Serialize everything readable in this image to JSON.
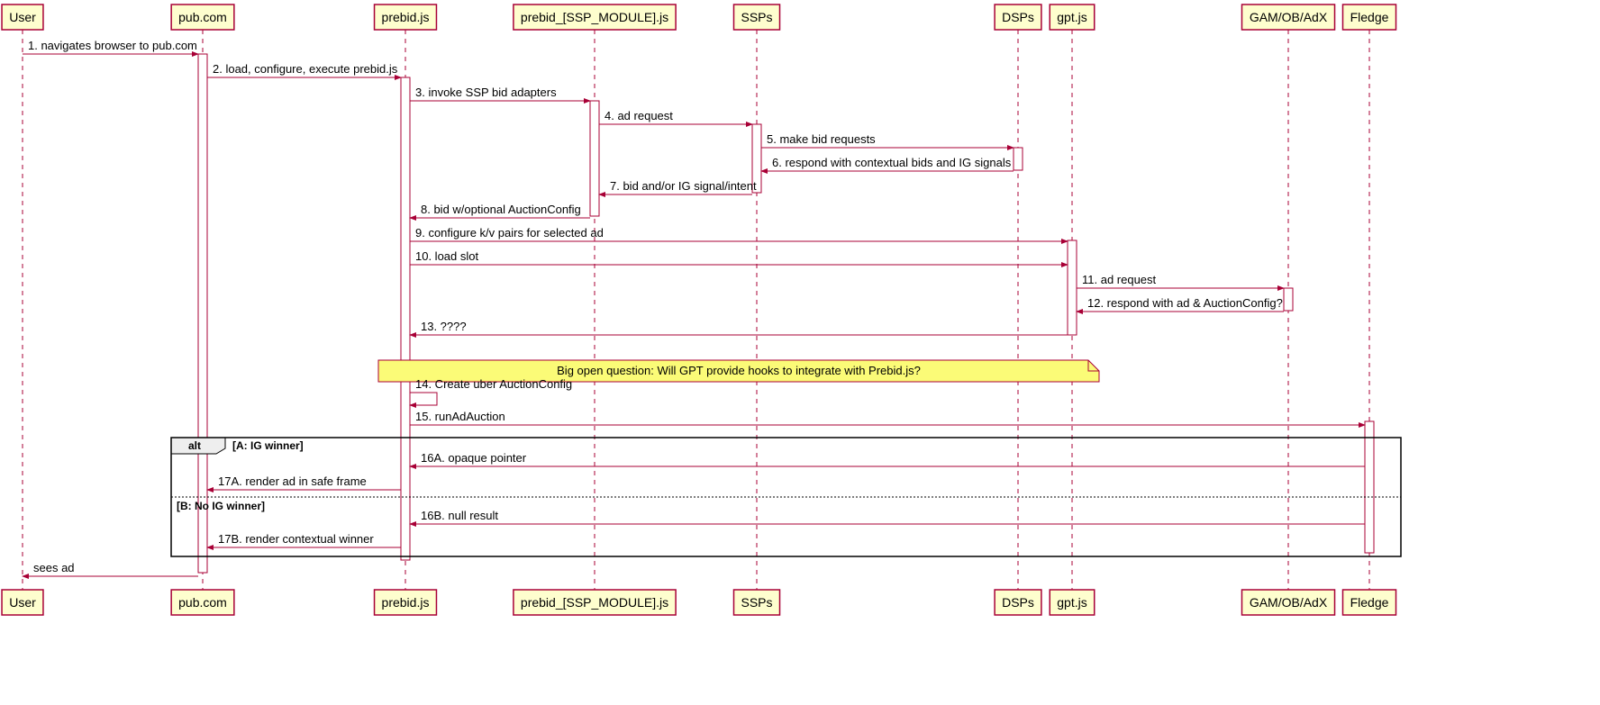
{
  "participants": [
    {
      "id": "user",
      "label": "User"
    },
    {
      "id": "pub",
      "label": "pub.com"
    },
    {
      "id": "prebid",
      "label": "prebid.js"
    },
    {
      "id": "module",
      "label": "prebid_[SSP_MODULE].js"
    },
    {
      "id": "ssps",
      "label": "SSPs"
    },
    {
      "id": "dsps",
      "label": "DSPs"
    },
    {
      "id": "gpt",
      "label": "gpt.js"
    },
    {
      "id": "gam",
      "label": "GAM/OB/AdX"
    },
    {
      "id": "fledge",
      "label": "Fledge"
    }
  ],
  "messages": {
    "m1": "1. navigates browser to pub.com",
    "m2": "2. load, configure, execute prebid.js",
    "m3": "3. invoke SSP bid adapters",
    "m4": "4. ad request",
    "m5": "5. make bid requests",
    "m6": "6. respond with contextual bids and IG signals",
    "m7": "7. bid and/or IG signal/intent",
    "m8": "8. bid w/optional AuctionConfig",
    "m9": "9. configure k/v pairs for selected ad",
    "m10": "10. load slot",
    "m11": "11. ad request",
    "m12": "12. respond with ad & AuctionConfig?",
    "m13": "13. ????",
    "m14": "14. Create uber AuctionConfig",
    "m15": "15. runAdAuction",
    "m16a": "16A. opaque pointer",
    "m17a": "17A. render ad in safe frame",
    "m16b": "16B. null result",
    "m17b": "17B. render contextual winner",
    "mlast": "sees ad"
  },
  "note": "Big open question: Will GPT provide hooks to integrate with Prebid.js?",
  "alt": {
    "label": "alt",
    "cond_a": "[A: IG winner]",
    "cond_b": "[B: No IG winner]"
  }
}
